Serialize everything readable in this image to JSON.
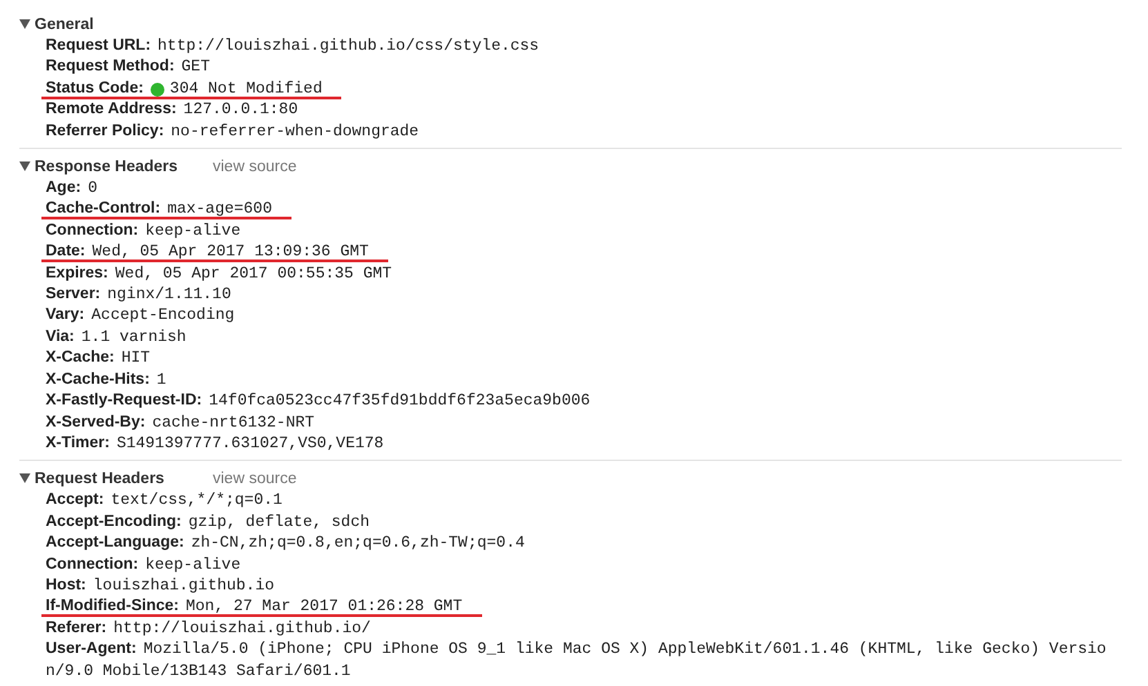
{
  "sections": [
    {
      "title": "General",
      "expanded": true,
      "rows": [
        {
          "name": "Request URL:",
          "value": "http://louiszhai.github.io/css/style.css",
          "underlined": false
        },
        {
          "name": "Request Method:",
          "value": "GET",
          "underlined": false
        },
        {
          "name": "Status Code:",
          "value": "304 Not Modified",
          "underlined": true,
          "color": "#2fb52f"
        },
        {
          "name": "Remote Address:",
          "value": "127.0.0.1:80",
          "underlined": false
        },
        {
          "name": "Referrer Policy:",
          "value": "no-referrer-when-downgrade",
          "underlined": false
        }
      ]
    },
    {
      "title": "Response Headers",
      "expanded": true,
      "link": "view source",
      "rows": [
        {
          "name": "Age:",
          "value": "0",
          "underlined": false
        },
        {
          "name": "Cache-Control:",
          "value": "max-age=600",
          "underlined": true
        },
        {
          "name": "Connection:",
          "value": "keep-alive",
          "underlined": false
        },
        {
          "name": "Date:",
          "value": "Wed, 05 Apr 2017 13:09:36 GMT",
          "underlined": true
        },
        {
          "name": "Expires:",
          "value": "Wed, 05 Apr 2017 00:55:35 GMT",
          "underlined": false
        },
        {
          "name": "Server:",
          "value": "nginx/1.11.10",
          "underlined": false
        },
        {
          "name": "Vary:",
          "value": "Accept-Encoding",
          "underlined": false
        },
        {
          "name": "Via:",
          "value": "1.1 varnish",
          "underlined": false
        },
        {
          "name": "X-Cache:",
          "value": "HIT",
          "underlined": false
        },
        {
          "name": "X-Cache-Hits:",
          "value": "1",
          "underlined": false
        },
        {
          "name": "X-Fastly-Request-ID:",
          "value": "14f0fca0523cc47f35fd91bddf6f23a5eca9b006",
          "underlined": false
        },
        {
          "name": "X-Served-By:",
          "value": "cache-nrt6132-NRT",
          "underlined": false
        },
        {
          "name": "X-Timer:",
          "value": "S1491397777.631027,VS0,VE178",
          "underlined": false
        }
      ]
    },
    {
      "title": "Request Headers",
      "expanded": true,
      "link": "view source",
      "rows": [
        {
          "name": "Accept:",
          "value": "text/css,*/*;q=0.1",
          "underlined": false
        },
        {
          "name": "Accept-Encoding:",
          "value": "gzip, deflate, sdch",
          "underlined": false
        },
        {
          "name": "Accept-Language:",
          "value": "zh-CN,zh;q=0.8,en;q=0.6,zh-TW;q=0.4",
          "underlined": false
        },
        {
          "name": "Connection:",
          "value": "keep-alive",
          "underlined": false
        },
        {
          "name": "Host:",
          "value": "louiszhai.github.io",
          "underlined": false
        },
        {
          "name": "If-Modified-Since:",
          "value": "Mon, 27 Mar 2017 01:26:28 GMT",
          "underlined": true
        },
        {
          "name": "Referer:",
          "value": "http://louiszhai.github.io/",
          "underlined": false
        },
        {
          "name": "User-Agent:",
          "value": "Mozilla/5.0 (iPhone; CPU iPhone OS 9_1 like Mac OS X) AppleWebKit/601.1.46 (KHTML, like Gecko) Version/9.0 Mobile/13B143 Safari/601.1",
          "underlined": false
        }
      ]
    }
  ]
}
